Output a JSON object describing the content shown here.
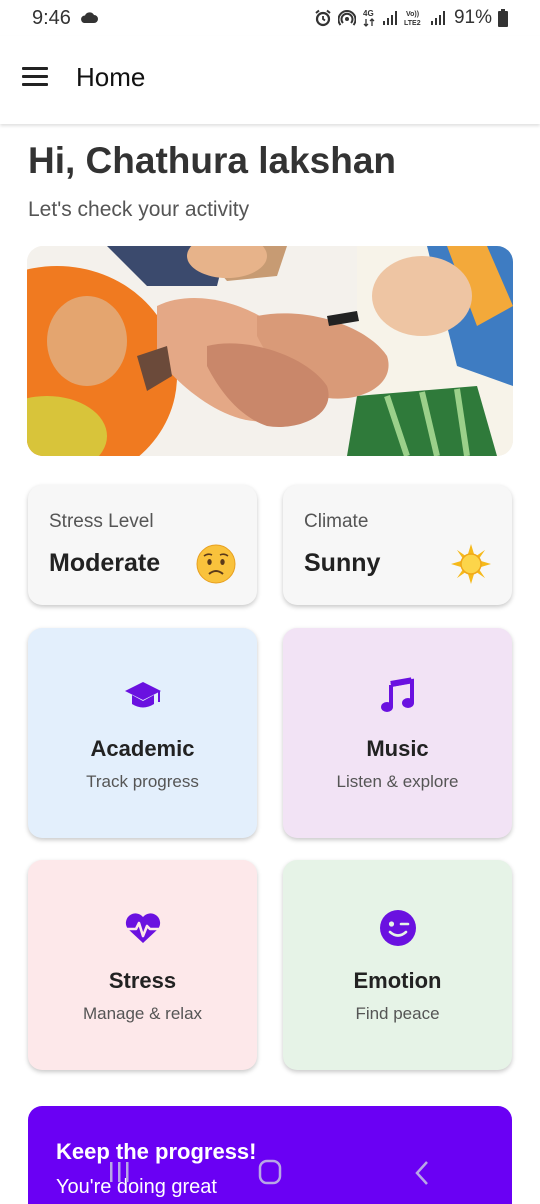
{
  "status_bar": {
    "time": "9:46",
    "battery": "91%",
    "icons": [
      "cloud-icon",
      "alarm-icon",
      "hotspot-icon",
      "4g-icon",
      "signal-icon",
      "volte-icon",
      "signal-icon",
      "battery-icon"
    ],
    "network_4g": "4G",
    "volte": "Vo)) LTE2"
  },
  "app_bar": {
    "title": "Home",
    "menu_icon": "menu-icon"
  },
  "greeting": {
    "title": "Hi, Chathura lakshan",
    "subtitle": "Let's check your activity"
  },
  "hero": {
    "image": "group of hands stacked together photo"
  },
  "info_cards": [
    {
      "label": "Stress Level",
      "value": "Moderate",
      "icon": "worried-face-icon"
    },
    {
      "label": "Climate",
      "value": "Sunny",
      "icon": "sun-icon"
    }
  ],
  "tiles": [
    {
      "title": "Academic",
      "subtitle": "Track progress",
      "icon": "graduation-cap-icon",
      "bg": "#e3effc"
    },
    {
      "title": "Music",
      "subtitle": "Listen & explore",
      "icon": "music-note-icon",
      "bg": "#f2e3f5"
    },
    {
      "title": "Stress",
      "subtitle": "Manage & relax",
      "icon": "heart-pulse-icon",
      "bg": "#fde8ea"
    },
    {
      "title": "Emotion",
      "subtitle": "Find peace",
      "icon": "wink-face-icon",
      "bg": "#e6f3e7"
    }
  ],
  "banner": {
    "title": "Keep the progress!",
    "subtitle": "You're doing great",
    "bg": "#6a00f4"
  },
  "colors": {
    "accent": "#6a00f4",
    "icon_purple": "#6a11e0"
  },
  "nav_bar": {
    "icons": [
      "recent-apps-icon",
      "home-icon",
      "back-icon"
    ]
  }
}
